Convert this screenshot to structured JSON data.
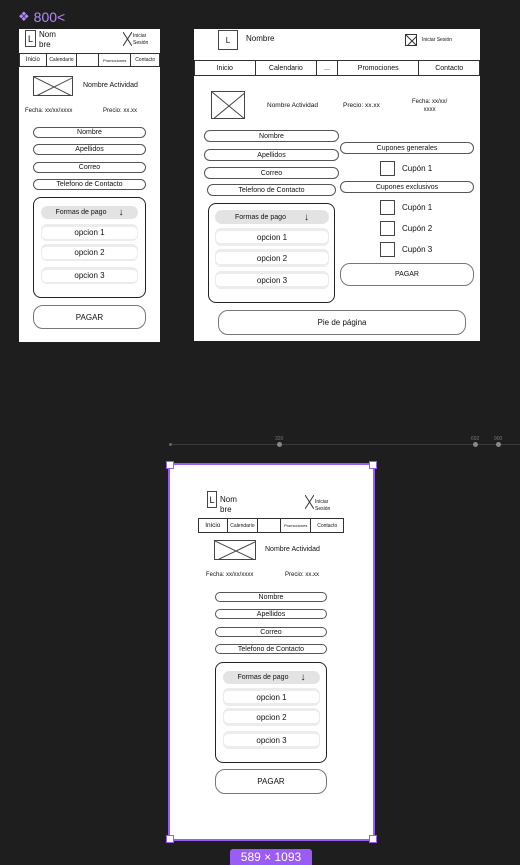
{
  "canvas": {
    "frame_label": "800<",
    "size_badge": "589 × 1093",
    "ruler_ticks": [
      "320",
      "692",
      "900"
    ]
  },
  "small": {
    "logo_letter": "L",
    "brand": "Nom\nbre",
    "login": "Iniciar\nSesión",
    "tabs": [
      "Inicio",
      "Calendario",
      "",
      "Promociones",
      "Contacto"
    ],
    "activity_name": "Nombre Actividad",
    "date": "Fecha: xx/xx/xxxx",
    "price": "Precio: xx.xx",
    "fields": [
      "Nombre",
      "Apellidos",
      "Correo",
      "Telefono de Contacto"
    ],
    "payment_title": "Formas de pago",
    "payment_options": [
      "opcion 1",
      "opcion 2",
      "opcion 3"
    ],
    "pay_button": "PAGAR"
  },
  "desktop": {
    "logo_letter": "L",
    "brand": "Nombre",
    "login": "Iniciar Sesión",
    "tabs": [
      "Inicio",
      "Calendario",
      "...",
      "Promociones",
      "Contacto"
    ],
    "activity_name": "Nombre Actividad",
    "price": "Precio: xx.xx",
    "date": "Fecha: xx/xx/\nxxxx",
    "fields": [
      "Nombre",
      "Apellidos",
      "Correo",
      "Telefono de Contacto"
    ],
    "payment_title": "Formas de pago",
    "payment_options": [
      "opcion 1",
      "opcion 2",
      "opcion 3"
    ],
    "coupons_general": "Cupones generales",
    "coupon_general_items": [
      "Cupón 1"
    ],
    "coupons_exclusive": "Cupones exclusivos",
    "coupon_exclusive_items": [
      "Cupón 1",
      "Cupón 2",
      "Cupón 3"
    ],
    "pay_button": "PAGAR",
    "footer": "Pie de página"
  },
  "mobile": {
    "logo_letter": "L",
    "brand": "Nom\nbre",
    "login": "Iniciar\nSesión",
    "tabs": [
      "Inicio",
      "Calendario",
      "",
      "Promociones",
      "Contacto"
    ],
    "activity_name": "Nombre Actividad",
    "date": "Fecha: xx/xx/xxxx",
    "price": "Precio: xx.xx",
    "fields": [
      "Nombre",
      "Apellidos",
      "Correo",
      "Telefono de Contacto"
    ],
    "payment_title": "Formas de pago",
    "payment_options": [
      "opcion 1",
      "opcion 2",
      "opcion 3"
    ],
    "pay_button": "PAGAR"
  },
  "colors": {
    "canvas_bg": "#1e1e1e",
    "selection": "#9b5cf5",
    "frame_label": "#b388ff"
  }
}
